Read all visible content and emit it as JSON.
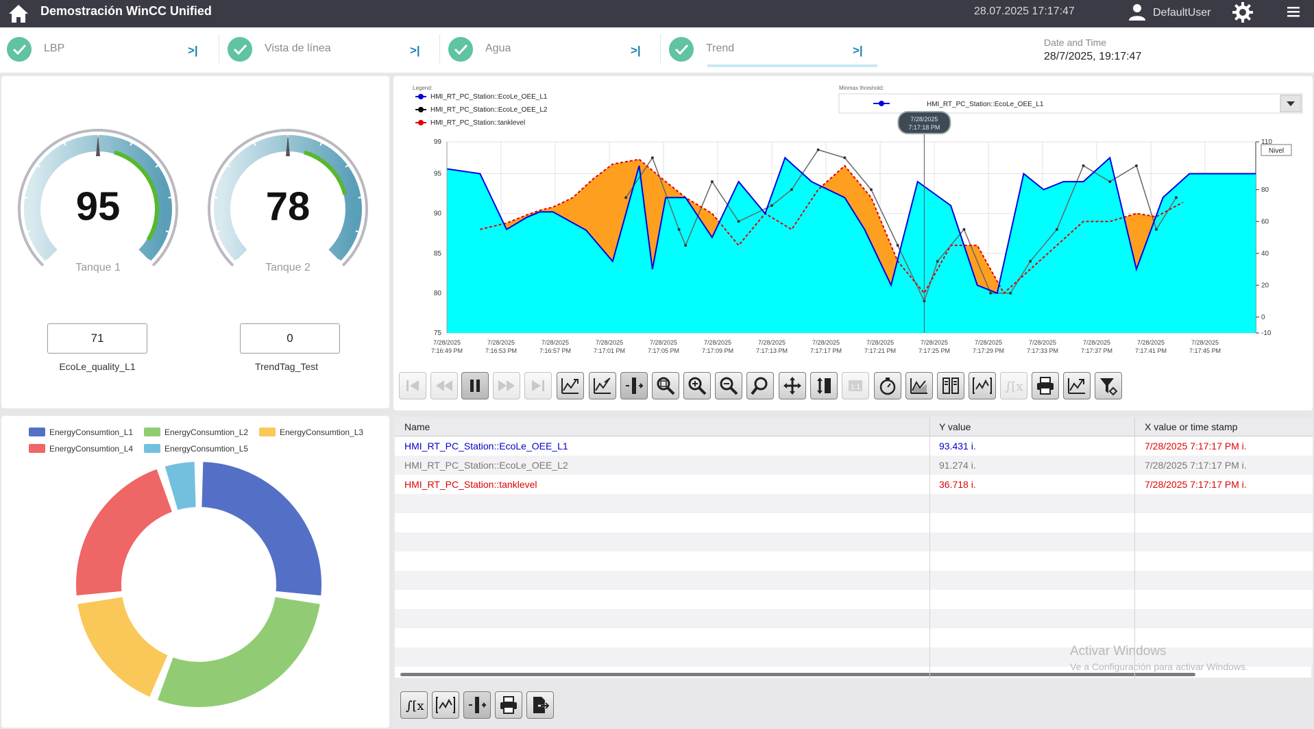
{
  "header": {
    "title": "Demostración WinCC Unified",
    "datetime": "28.07.2025 17:17:47",
    "user": "DefaultUser"
  },
  "tabs": [
    {
      "label": "LBP"
    },
    {
      "label": "Vista de línea"
    },
    {
      "label": "Agua"
    },
    {
      "label": "Trend",
      "active": true
    }
  ],
  "date_time_widget": {
    "label": "Date and Time",
    "value": "28/7/2025, 19:17:47"
  },
  "gauges": [
    {
      "value": "95",
      "label": "Tanque 1",
      "fraction": 0.95
    },
    {
      "value": "78",
      "label": "Tanque 2",
      "fraction": 0.78
    }
  ],
  "value_fields": [
    {
      "value": "71",
      "caption": "EcoLe_quality_L1"
    },
    {
      "value": "0",
      "caption": "TrendTag_Test"
    }
  ],
  "trend": {
    "legend_title": "Legend:",
    "legend": [
      {
        "name": "HMI_RT_PC_Station::EcoLe_OEE_L1",
        "color": "#0000e0"
      },
      {
        "name": "HMI_RT_PC_Station::EcoLe_OEE_L2",
        "color": "#000000"
      },
      {
        "name": "HMI_RT_PC_Station::tanklevel",
        "color": "#e00000"
      }
    ],
    "minmax_label": "Minmax threshold:",
    "minmax_value": "HMI_RT_PC_Station::EcoLe_OEE_L1",
    "right_axis_label": "Nivel",
    "cursor_date": "7/28/2025",
    "cursor_time": "7:17:18 PM"
  },
  "chart_data": {
    "type": "area",
    "y_left_range": [
      75,
      99
    ],
    "y_left_ticks": [
      "99",
      "95",
      "90",
      "85",
      "80",
      "75"
    ],
    "y_right_range": [
      -10,
      110
    ],
    "y_right_ticks": [
      "110",
      "80",
      "60",
      "40",
      "20",
      "0",
      "-10"
    ],
    "x_ticks": [
      {
        "date": "7/28/2025",
        "time": "7:16:49 PM"
      },
      {
        "date": "7/28/2025",
        "time": "7:16:53 PM"
      },
      {
        "date": "7/28/2025",
        "time": "7:16:57 PM"
      },
      {
        "date": "7/28/2025",
        "time": "7:17:01 PM"
      },
      {
        "date": "7/28/2025",
        "time": "7:17:05 PM"
      },
      {
        "date": "7/28/2025",
        "time": "7:17:09 PM"
      },
      {
        "date": "7/28/2025",
        "time": "7:17:13 PM"
      },
      {
        "date": "7/28/2025",
        "time": "7:17:17 PM"
      },
      {
        "date": "7/28/2025",
        "time": "7:17:21 PM"
      },
      {
        "date": "7/28/2025",
        "time": "7:17:25 PM"
      },
      {
        "date": "7/28/2025",
        "time": "7:17:29 PM"
      },
      {
        "date": "7/28/2025",
        "time": "7:17:33 PM"
      },
      {
        "date": "7/28/2025",
        "time": "7:17:37 PM"
      },
      {
        "date": "7/28/2025",
        "time": "7:17:41 PM"
      },
      {
        "date": "7/28/2025",
        "time": "7:17:45 PM"
      }
    ],
    "x_seconds": [
      0,
      1,
      2,
      3,
      4,
      5,
      6,
      7,
      8,
      9,
      10,
      11,
      12,
      13,
      14,
      15,
      16,
      17,
      18,
      19,
      20,
      21,
      22,
      23,
      24,
      25,
      26,
      27,
      28,
      29,
      30,
      31,
      32,
      33,
      34,
      35,
      36,
      37,
      38,
      39,
      40,
      41,
      42,
      43,
      44,
      45,
      46,
      47,
      48,
      49,
      50,
      51,
      52,
      53,
      54,
      55,
      56,
      57,
      58,
      59,
      60,
      61
    ],
    "series": [
      {
        "name": "HMI_RT_PC_Station::EcoLe_OEE_L1",
        "color": "#0000e0",
        "fill": "#00ffff",
        "x": [
          0,
          2.5,
          4.5,
          6,
          7,
          8,
          10.5,
          12.5,
          14.5,
          15.5,
          16.5,
          18,
          20,
          22,
          24,
          25.5,
          27.5,
          30,
          31.5,
          33.5,
          35.5,
          38,
          40,
          41.5,
          43.5,
          45,
          46.5,
          48,
          50,
          52,
          54,
          56,
          57.5,
          59.5,
          61
        ],
        "y": [
          95.6,
          95.0,
          88.0,
          89.5,
          90.2,
          90.2,
          87.9,
          84.0,
          96.0,
          83.0,
          92.0,
          92.0,
          87.0,
          94.0,
          90.0,
          97.0,
          94.0,
          92.0,
          88.0,
          81.0,
          94.0,
          91.0,
          81.0,
          80.0,
          95.0,
          93.0,
          94.0,
          94.0,
          97.0,
          83.0,
          92.0,
          95.0,
          95.0,
          95.0,
          95.0
        ]
      },
      {
        "name": "HMI_RT_PC_Station::EcoLe_OEE_L2",
        "color": "#666666",
        "x": [
          13.5,
          15.5,
          17.5,
          18,
          20,
          22,
          24.5,
          26,
          28,
          30,
          32,
          34,
          36,
          37,
          39,
          41,
          42.5,
          44,
          46,
          48,
          50,
          52,
          53.5,
          55
        ],
        "y": [
          92.0,
          97.0,
          88.0,
          86.0,
          94.0,
          89.0,
          91.0,
          93.0,
          98.0,
          97.0,
          93.0,
          86.0,
          79.0,
          84.0,
          88.0,
          80.0,
          80.0,
          84.0,
          88.0,
          96.0,
          94.0,
          96.0,
          88.0,
          92.0
        ]
      },
      {
        "name": "HMI_RT_PC_Station::tanklevel",
        "color": "#e00000",
        "x": [
          2.5,
          4.5,
          6,
          7,
          8,
          9.5,
          11,
          12.5,
          14.5,
          16.5,
          18,
          20,
          22,
          24,
          26,
          28,
          30,
          32,
          34,
          36,
          38,
          40,
          42,
          44,
          46,
          48,
          50,
          52,
          53.5,
          55.5
        ],
        "y": [
          88.0,
          88.8,
          89.8,
          90.4,
          90.8,
          92.0,
          94.3,
          96.2,
          96.8,
          94.0,
          92.0,
          90.0,
          86.0,
          90.0,
          88.0,
          93.0,
          96.0,
          92.0,
          84.0,
          80.0,
          86.0,
          86.0,
          80.0,
          83.0,
          86.0,
          89.0,
          89.0,
          90.0,
          89.6,
          91.4
        ]
      }
    ],
    "cursor_x": 36
  },
  "toolbar_names": [
    "first",
    "prev",
    "pause",
    "next",
    "last",
    "zoom-in-x",
    "zoom-out-x",
    "ruler",
    "zoom-area",
    "zoom-in",
    "zoom-out",
    "zoom-reset",
    "move",
    "move-y",
    "one-to-one",
    "stopwatch",
    "trend-add",
    "columns",
    "bracket-trend",
    "integral",
    "print",
    "export-chart",
    "filter"
  ],
  "donut": {
    "legend": [
      {
        "name": "EnergyConsumtion_L1",
        "color": "#5470c6"
      },
      {
        "name": "EnergyConsumtion_L2",
        "color": "#91cc75"
      },
      {
        "name": "EnergyConsumtion_L3",
        "color": "#fac858"
      },
      {
        "name": "EnergyConsumtion_L4",
        "color": "#ee6666"
      },
      {
        "name": "EnergyConsumtion_L5",
        "color": "#73c0de"
      }
    ],
    "values": [
      27,
      29,
      17,
      22,
      5
    ]
  },
  "table": {
    "headers": [
      "Name",
      "Y value",
      "X value or time stamp"
    ],
    "rows": [
      {
        "name": "HMI_RT_PC_Station::EcoLe_OEE_L1",
        "y": "93.431 i.",
        "x": "7/28/2025 7:17:17 PM i.",
        "color": "#0000c8"
      },
      {
        "name": "HMI_RT_PC_Station::EcoLe_OEE_L2",
        "y": "91.274 i.",
        "x": "7/28/2025 7:17:17 PM i.",
        "color": "#777777"
      },
      {
        "name": "HMI_RT_PC_Station::tanklevel",
        "y": "36.718 i.",
        "x": "7/28/2025 7:17:17 PM i.",
        "color": "#e00000"
      }
    ],
    "watermark_title": "Activar Windows",
    "watermark_sub": "Ve a Configuración para activar Windows."
  }
}
